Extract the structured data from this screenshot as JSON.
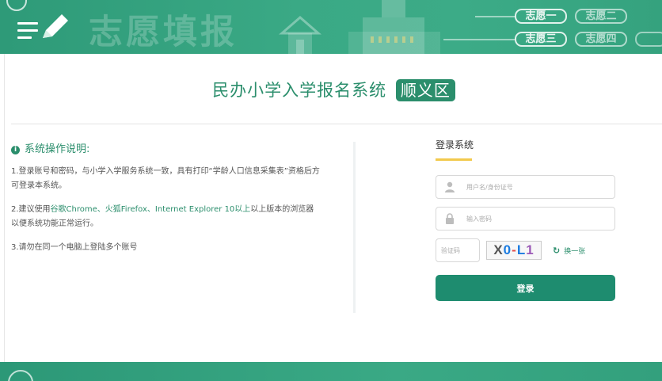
{
  "header": {
    "banner_title": "志愿填报",
    "choices": [
      "志愿一",
      "志愿二",
      "志愿三",
      "志愿四"
    ]
  },
  "system": {
    "title": "民办小学入学报名系统",
    "district": "顺义区"
  },
  "instructions": {
    "heading": "系统操作说明:",
    "item1": "1.登录账号和密码，与小学入学服务系统一致，具有打印“学龄人口信息采集表”资格后方可登录本系统。",
    "item2_prefix": "2.建议使用",
    "item2_highlight": "谷歌Chrome、火狐Firefox、Internet Explorer 10以上",
    "item2_suffix": "以上版本的浏览器以便系统功能正常运行。",
    "item3": "3.请勿在同一个电脑上登陆多个账号"
  },
  "login": {
    "title": "登录系统",
    "username_placeholder": "用户名/身份证号",
    "password_placeholder": "输入密码",
    "captcha_placeholder": "验证码",
    "captcha_chars": [
      "X",
      "0",
      "-",
      "L",
      "1"
    ],
    "refresh_label": "换一张",
    "submit_label": "登录"
  },
  "colors": {
    "brand_green": "#2b8e6c",
    "button_green": "#1e8c6f",
    "accent_yellow": "#f2c94c"
  }
}
